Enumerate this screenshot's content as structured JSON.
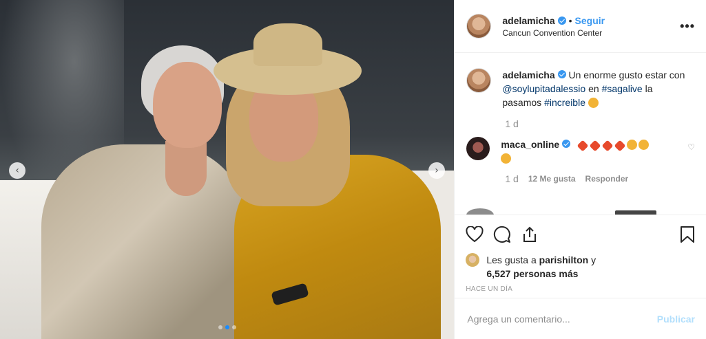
{
  "header": {
    "username": "adelamicha",
    "separator": "•",
    "follow_label": "Seguir",
    "location": "Cancun Convention Center",
    "more_icon": "more-options-icon"
  },
  "caption": {
    "username": "adelamicha",
    "text_1": "Un enorme gusto estar con ",
    "mention": "@soylupitadalessio",
    "text_2": " en ",
    "tag_1": "#sagalive",
    "text_3": " la pasamos ",
    "tag_2": "#increible",
    "time": "1 d"
  },
  "comment": {
    "username": "maca_online",
    "time": "1 d",
    "likes": "12 Me gusta",
    "reply": "Responder"
  },
  "likes": {
    "prefix": "Les gusta a ",
    "user": "parishilton",
    "suffix": " y",
    "others": "6,527 personas más"
  },
  "timestamp": "HACE UN DÍA",
  "add_comment": {
    "placeholder": "Agrega un comentario...",
    "publish": "Publicar"
  },
  "carousel": {
    "prev": "‹",
    "next": "›",
    "dots": 3,
    "active_dot": 2
  },
  "colors": {
    "link": "#003569",
    "accent": "#3897f0",
    "muted": "#8e8e8e"
  }
}
